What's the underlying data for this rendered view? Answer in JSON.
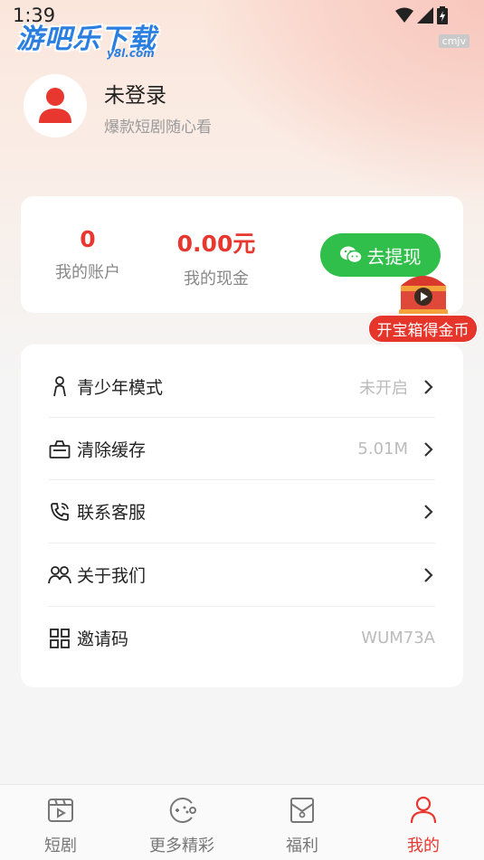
{
  "status_bar": {
    "time": "1:39"
  },
  "watermark": {
    "logo": "游吧乐下载",
    "sub": "y8l.com",
    "tag": "cmjv"
  },
  "profile": {
    "name": "未登录",
    "subtitle": "爆款短剧随心看"
  },
  "balance": {
    "account_value": "0",
    "account_label": "我的账户",
    "cash_value": "0.00元",
    "cash_label": "我的现金",
    "withdraw_label": "去提现"
  },
  "treasure": {
    "label": "开宝箱得金币"
  },
  "menu": [
    {
      "icon": "youth-mode-icon",
      "label": "青少年模式",
      "value": "未开启",
      "arrow": true
    },
    {
      "icon": "clear-cache-icon",
      "label": "清除缓存",
      "value": "5.01M",
      "arrow": true
    },
    {
      "icon": "phone-service-icon",
      "label": "联系客服",
      "value": "",
      "arrow": true
    },
    {
      "icon": "about-us-icon",
      "label": "关于我们",
      "value": "",
      "arrow": true
    },
    {
      "icon": "qr-code-icon",
      "label": "邀请码",
      "value": "WUM73A",
      "arrow": false
    }
  ],
  "tabs": [
    {
      "icon": "short-drama-icon",
      "label": "短剧",
      "active": false
    },
    {
      "icon": "game-icon",
      "label": "更多精彩",
      "active": false
    },
    {
      "icon": "welfare-icon",
      "label": "福利",
      "active": false
    },
    {
      "icon": "profile-icon",
      "label": "我的",
      "active": true
    }
  ],
  "colors": {
    "accent": "#e8372f",
    "wechat_green": "#2fbf4a"
  }
}
